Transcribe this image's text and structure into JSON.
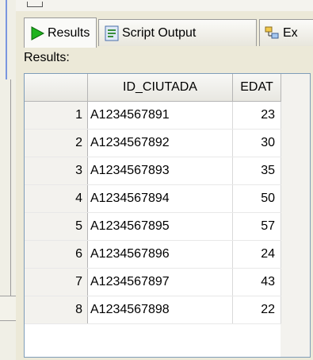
{
  "tabs": [
    {
      "label": "Results",
      "icon": "play-icon"
    },
    {
      "label": "Script Output",
      "icon": "script-icon"
    },
    {
      "label": "Ex",
      "icon": "explain-plan-icon"
    }
  ],
  "results_label": "Results:",
  "grid": {
    "columns": [
      "",
      "ID_CIUTADA",
      "EDAT"
    ],
    "rows": [
      {
        "num": "1",
        "id": "A1234567891",
        "edat": "23"
      },
      {
        "num": "2",
        "id": "A1234567892",
        "edat": "30"
      },
      {
        "num": "3",
        "id": "A1234567893",
        "edat": "35"
      },
      {
        "num": "4",
        "id": "A1234567894",
        "edat": "50"
      },
      {
        "num": "5",
        "id": "A1234567895",
        "edat": "57"
      },
      {
        "num": "6",
        "id": "A1234567896",
        "edat": "24"
      },
      {
        "num": "7",
        "id": "A1234567897",
        "edat": "43"
      },
      {
        "num": "8",
        "id": "A1234567898",
        "edat": "22"
      }
    ]
  },
  "colors": {
    "play": "#1db31d",
    "accent": "#7a96df"
  }
}
